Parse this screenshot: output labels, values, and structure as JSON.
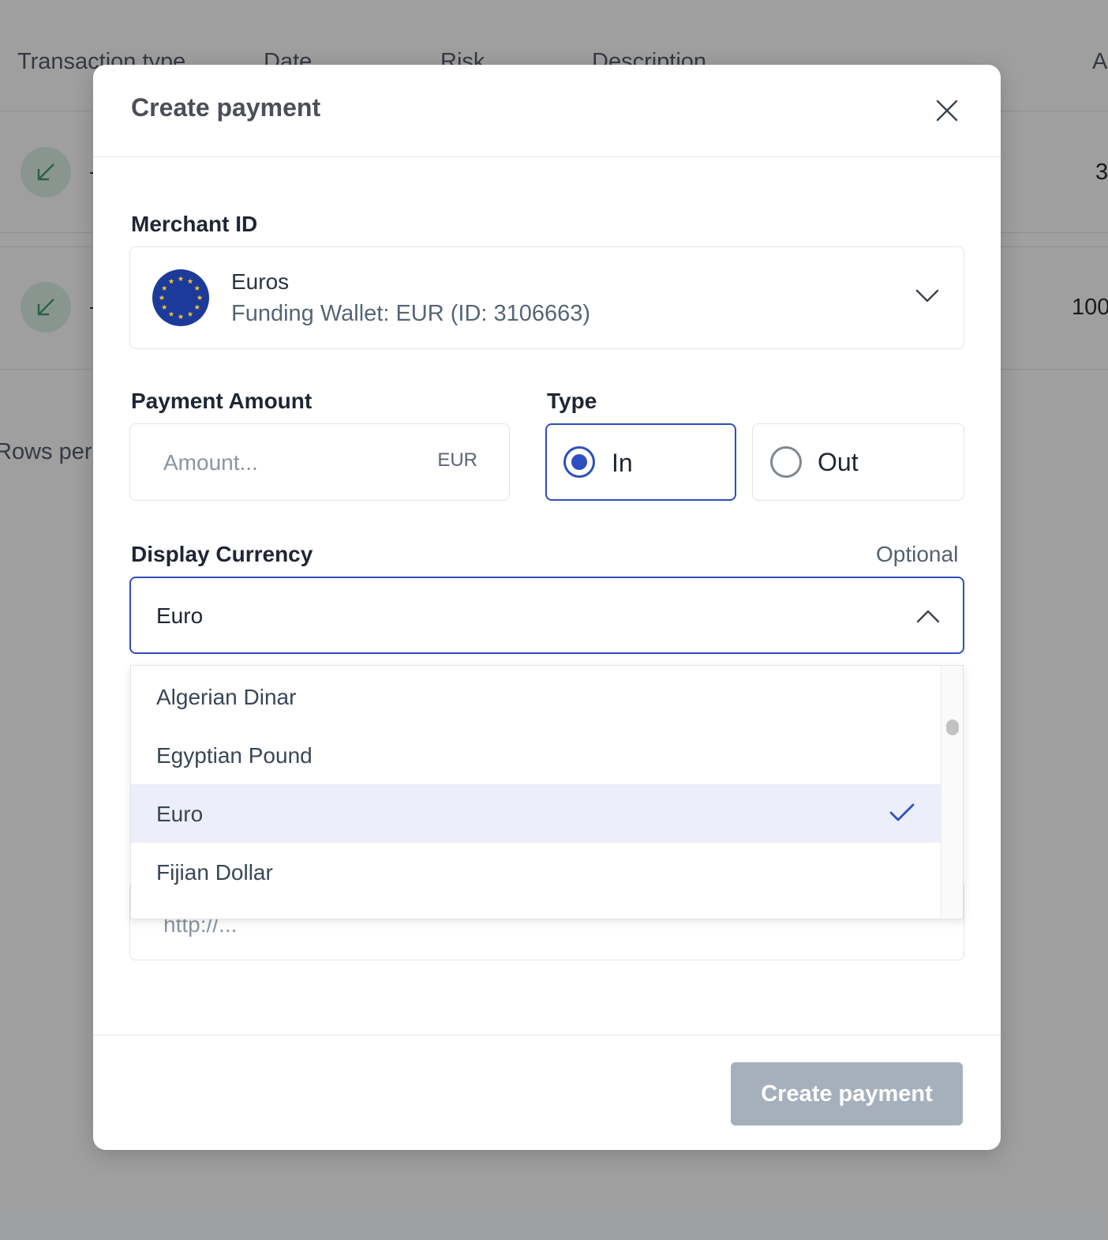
{
  "background": {
    "columns": [
      "Transaction type",
      "Date",
      "Risk",
      "Description",
      "A"
    ],
    "rows": [
      {
        "amount": "3"
      },
      {
        "amount": "100"
      }
    ],
    "rows_per_page_label": "Rows per"
  },
  "modal": {
    "title": "Create payment",
    "merchant": {
      "label": "Merchant ID",
      "name": "Euros",
      "wallet": "Funding Wallet: EUR (ID: 3106663)",
      "flag_icon": "eu-flag-icon"
    },
    "payment_amount": {
      "label": "Payment Amount",
      "placeholder": "Amount...",
      "value": "",
      "unit": "EUR"
    },
    "type": {
      "label": "Type",
      "options": [
        {
          "label": "In",
          "selected": true
        },
        {
          "label": "Out",
          "selected": false
        }
      ]
    },
    "display_currency": {
      "label": "Display Currency",
      "optional_label": "Optional",
      "selected": "Euro",
      "options": [
        {
          "label": "Algerian Dinar",
          "selected": false
        },
        {
          "label": "Egyptian Pound",
          "selected": false
        },
        {
          "label": "Euro",
          "selected": true
        },
        {
          "label": "Fijian Dollar",
          "selected": false
        }
      ]
    },
    "url_field": {
      "placeholder": "http://..."
    },
    "submit_label": "Create payment"
  },
  "colors": {
    "accent": "#2e4fbf",
    "selected_option_bg": "#eceefa",
    "disabled_button": "#a6b0bd",
    "flag_blue": "#1c3a9a",
    "flag_star": "#f4c430"
  }
}
